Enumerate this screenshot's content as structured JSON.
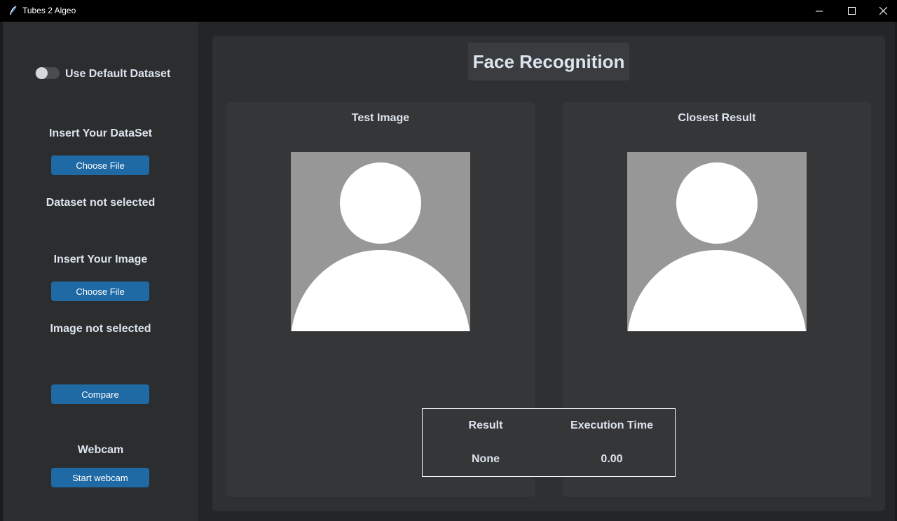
{
  "window": {
    "title": "Tubes 2 Algeo",
    "icons": [
      "feather-icon",
      "minimize-icon",
      "maximize-icon",
      "close-icon"
    ]
  },
  "sidebar": {
    "switch_label": "Use Default Dataset",
    "switch_on": false,
    "dataset_heading": "Insert Your DataSet",
    "dataset_button": "Choose File",
    "dataset_status": "Dataset not selected",
    "image_heading": "Insert Your Image",
    "image_button": "Choose File",
    "image_status": "Image not selected",
    "compare_button": "Compare",
    "webcam_heading": "Webcam",
    "webcam_button": "Start webcam"
  },
  "main": {
    "title": "Face Recognition",
    "test_image_title": "Test Image",
    "closest_result_title": "Closest Result",
    "avatar_icon": "user-placeholder-icon",
    "results": {
      "result_header": "Result",
      "time_header": "Execution Time",
      "result_value": "None",
      "time_value": "0.00"
    }
  },
  "colors": {
    "accent": "#1f6aa5",
    "sidebar_bg": "#2b2d2e",
    "panel_bg": "#2e3032",
    "card_bg": "#353638",
    "text": "#dce4ee"
  }
}
